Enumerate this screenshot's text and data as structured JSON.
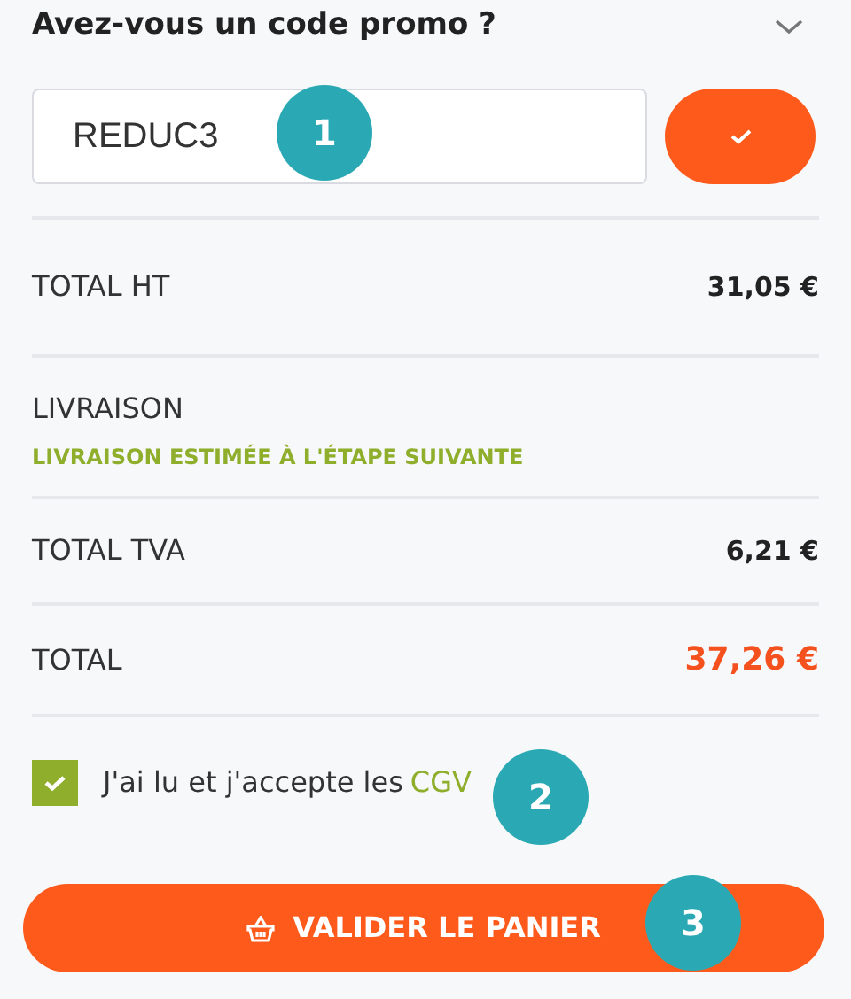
{
  "promo": {
    "title": "Avez-vous un code promo ?",
    "expanded": true,
    "code": "REDUC3"
  },
  "rows": [
    {
      "kind": "line",
      "label": "TOTAL HT",
      "value": "31,05 €"
    },
    {
      "kind": "shipping",
      "label": "LIVRAISON",
      "note": "LIVRAISON ESTIMÉE À L'ÉTAPE SUIVANTE"
    },
    {
      "kind": "line",
      "label": "TOTAL TVA",
      "value": "6,21 €"
    },
    {
      "kind": "total",
      "label": "TOTAL",
      "value": "37,26 €"
    }
  ],
  "terms": {
    "checked": true,
    "text": "J'ai lu et j'accepte les",
    "link": "CGV"
  },
  "submit": {
    "label": "VALIDER LE PANIER"
  },
  "callouts": [
    "1",
    "2",
    "3"
  ]
}
